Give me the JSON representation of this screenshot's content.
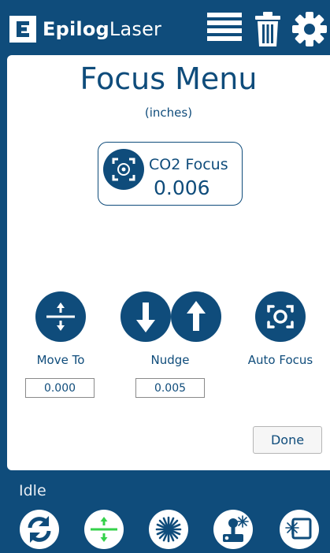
{
  "header": {
    "brand_bold": "Epilog",
    "brand_light": "Laser",
    "icons": [
      "list-icon",
      "trash-icon",
      "settings-icon"
    ]
  },
  "page": {
    "title": "Focus Menu",
    "units": "(inches)"
  },
  "focus": {
    "name": "CO2 Focus",
    "value": "0.006"
  },
  "controls": {
    "move_to_label": "Move To",
    "move_to_value": "0.000",
    "nudge_label": "Nudge",
    "nudge_value": "0.005",
    "auto_focus_label": "Auto Focus"
  },
  "done_label": "Done",
  "status": "Idle",
  "bottom_bar": [
    "refresh-icon",
    "focus-icon",
    "laser-burst-icon",
    "jog-icon",
    "frame-icon"
  ],
  "colors": {
    "brand_blue": "#0f4c7b",
    "focus_green": "#35d14a"
  }
}
